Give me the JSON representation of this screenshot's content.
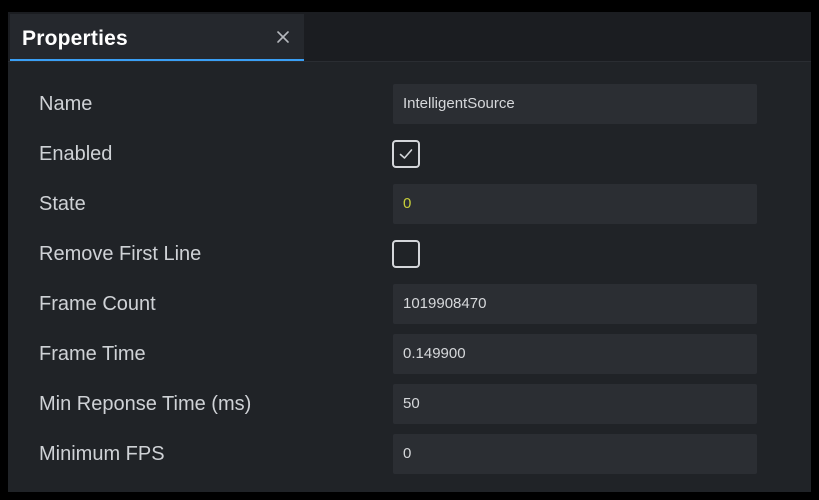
{
  "panel": {
    "tab_title": "Properties",
    "close_glyph": "close-icon",
    "accent_color": "#3a9ff5"
  },
  "properties": [
    {
      "label": "Name",
      "type": "text",
      "value": "IntelligentSource"
    },
    {
      "label": "Enabled",
      "type": "checkbox",
      "checked": true
    },
    {
      "label": "State",
      "type": "text",
      "value": "0",
      "value_color": "#c8cf3a"
    },
    {
      "label": "Remove First Line",
      "type": "checkbox",
      "checked": false
    },
    {
      "label": "Frame Count",
      "type": "text",
      "value": "1019908470"
    },
    {
      "label": "Frame Time",
      "type": "text",
      "value": "0.149900"
    },
    {
      "label": "Min Reponse Time (ms)",
      "type": "text",
      "value": "50"
    },
    {
      "label": "Minimum FPS",
      "type": "text",
      "value": "0"
    }
  ]
}
